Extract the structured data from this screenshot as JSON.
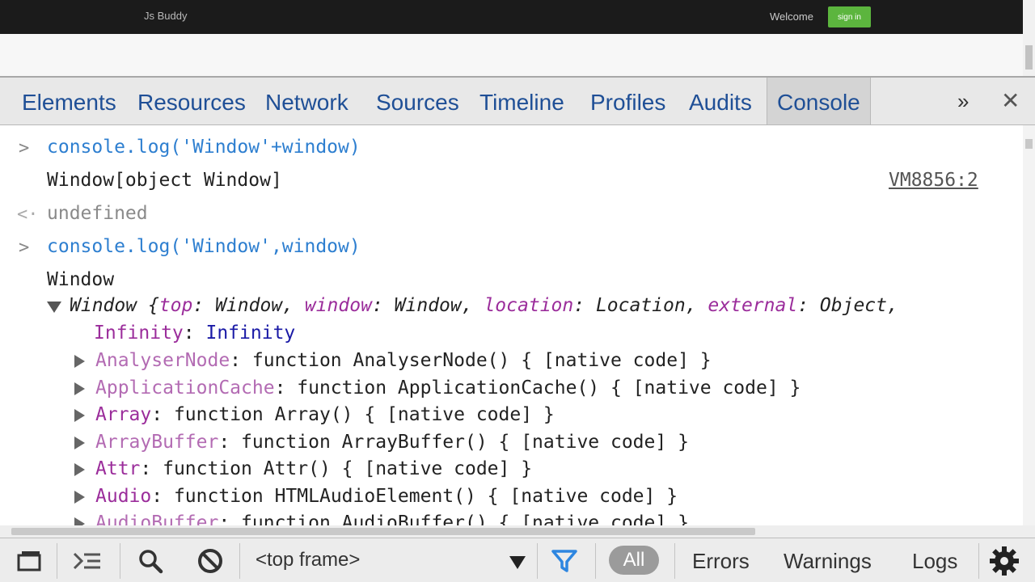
{
  "site": {
    "brand": "Js Buddy",
    "welcome": "Welcome",
    "signin": "sign in"
  },
  "tabs": [
    "Elements",
    "Resources",
    "Network",
    "Sources",
    "Timeline",
    "Profiles",
    "Audits",
    "Console"
  ],
  "active_tab": "Console",
  "console": {
    "cmd1": "console.log('Window'+window)",
    "out1": "Window[object Window]",
    "source1": "VM8856:2",
    "ret1": "undefined",
    "cmd2": "console.log('Window',window)",
    "out2": "Window",
    "obj_summary": {
      "name": "Window",
      "open": "{",
      "k1": "top",
      "v1": "Window",
      "k2": "window",
      "v2": "Window",
      "k3": "location",
      "v3": "Location",
      "k4": "external",
      "v4": "Object"
    },
    "props": [
      {
        "key": "Infinity",
        "value": "Infinity"
      },
      {
        "key": "AnalyserNode",
        "value": "function AnalyserNode() { [native code] }"
      },
      {
        "key": "ApplicationCache",
        "value": "function ApplicationCache() { [native code] }"
      },
      {
        "key": "Array",
        "value": "function Array() { [native code] }"
      },
      {
        "key": "ArrayBuffer",
        "value": "function ArrayBuffer() { [native code] }"
      },
      {
        "key": "Attr",
        "value": "function Attr() { [native code] }"
      },
      {
        "key": "Audio",
        "value": "function HTMLAudioElement() { [native code] }"
      },
      {
        "key": "AudioBuffer",
        "value": "function AudioBuffer() { [native code] }"
      }
    ]
  },
  "bottom": {
    "frame": "<top frame>",
    "filters": [
      "All",
      "Errors",
      "Warnings",
      "Logs"
    ]
  },
  "colors": {
    "accent_blue": "#2e7fd0",
    "property_purple": "#9b2d9b",
    "signin_green": "#5cb53e"
  }
}
